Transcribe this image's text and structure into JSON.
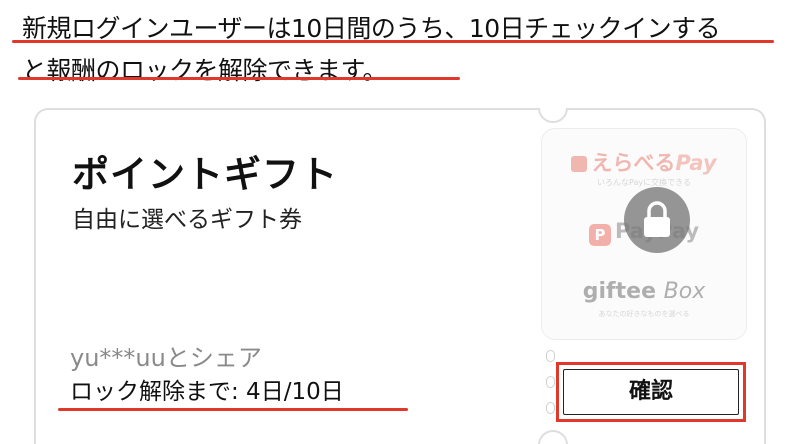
{
  "notice": {
    "line1": "新規ログインユーザーは10日間のうち、10日チェックインする",
    "line2": "と報酬のロックを解除できます。"
  },
  "ticket": {
    "title": "ポイントギフト",
    "subtitle": "自由に選べるギフト券",
    "share_text": "yu***uuとシェア",
    "unlock_progress_label": "ロック解除まで: 4日/10日",
    "unlock_progress": {
      "current": 4,
      "total": 10
    },
    "confirm_label": "確認"
  },
  "thumbnail": {
    "brands": [
      {
        "name": "えらべる",
        "suffix": "Pay",
        "tagline": "いろんなPayに交換できる"
      },
      {
        "name": "PayPay",
        "mark": "P"
      },
      {
        "name": "giftee",
        "suffix": "Box",
        "tagline": "あなたの好きなものを選べる"
      }
    ],
    "icon": "lock-icon"
  },
  "colors": {
    "accent_red": "#e0382b",
    "muted_text": "#8a8a8a",
    "card_border": "#dedede"
  }
}
